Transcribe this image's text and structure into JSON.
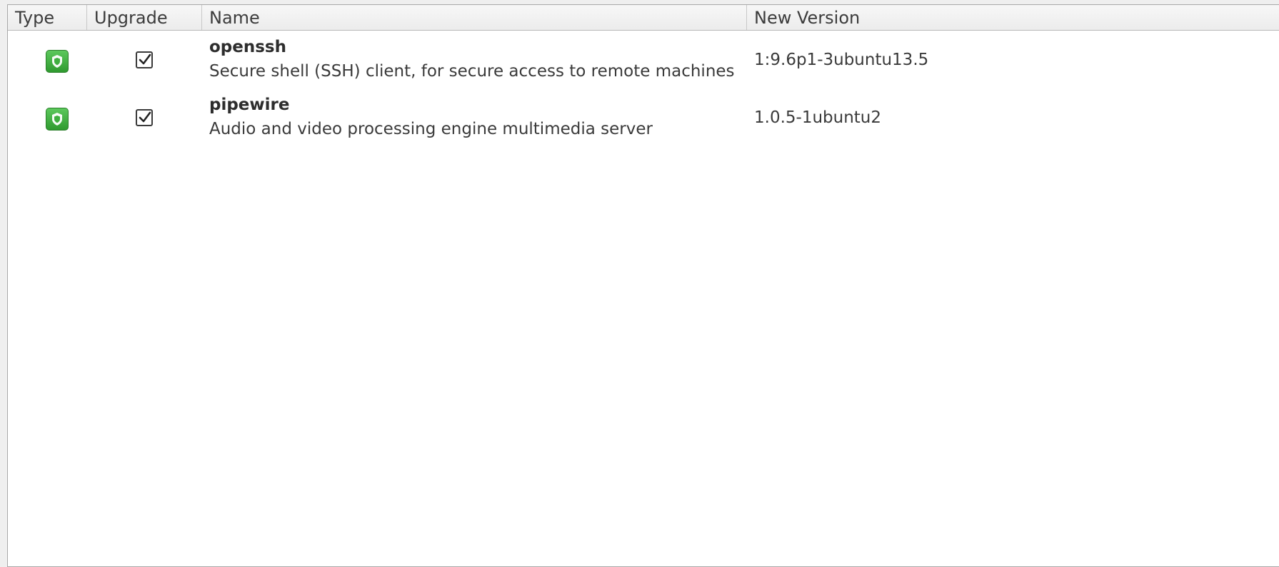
{
  "columns": {
    "type": "Type",
    "upgrade": "Upgrade",
    "name": "Name",
    "new_version": "New Version"
  },
  "packages": [
    {
      "type_icon": "security-shield-icon",
      "upgrade_checked": true,
      "name": "openssh",
      "description": "Secure shell (SSH) client, for secure access to remote machines",
      "new_version": "1:9.6p1-3ubuntu13.5"
    },
    {
      "type_icon": "security-shield-icon",
      "upgrade_checked": true,
      "name": "pipewire",
      "description": "Audio and video processing engine multimedia server",
      "new_version": "1.0.5-1ubuntu2"
    }
  ],
  "colors": {
    "security_icon": "#3fae3f",
    "header_bg": "#efefef",
    "list_bg": "#ffffff"
  }
}
